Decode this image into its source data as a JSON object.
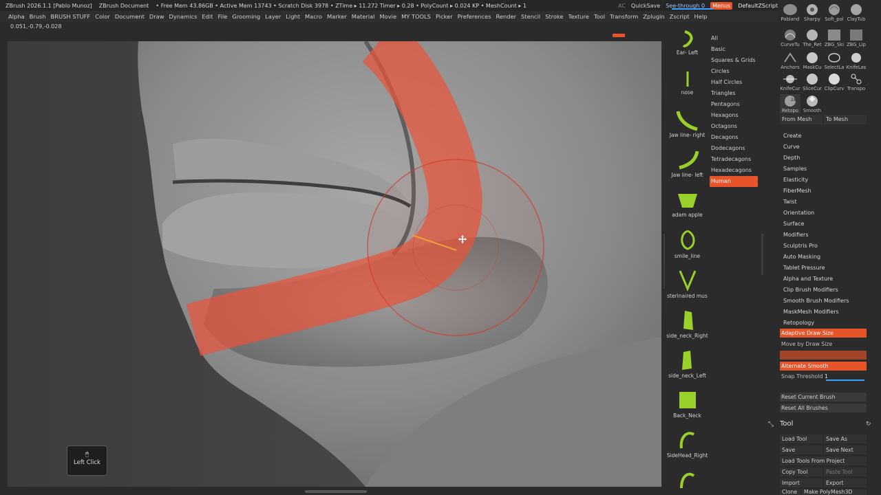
{
  "titlebar": {
    "app": "ZBrush 2026.1.1 [Pablo Munoz]",
    "document": "ZBrush Document",
    "stats": "• Free Mem 43.86GB • Active Mem 13743 • Scratch Disk 3978 • ZTime ▸ 11.272 Timer ▸ 0.28 • PolyCount ▸ 0.024 KP • MeshCount ▸ 1",
    "ac": "AC",
    "quicksave": "QuickSave",
    "see_through_label": "See-through",
    "see_through_value": "0",
    "menus": "Menus",
    "default_script": "DefaultZScript"
  },
  "menubar": [
    "Alpha",
    "Brush",
    "BRUSH STUFF",
    "Color",
    "Document",
    "Draw",
    "Dynamics",
    "Edit",
    "File",
    "Grooming",
    "Layer",
    "Light",
    "Macro",
    "Marker",
    "Material",
    "Movie",
    "MY TOOLS",
    "Picker",
    "Preferences",
    "Render",
    "Stencil",
    "Stroke",
    "Texture",
    "Tool",
    "Transform",
    "Zplugin",
    "Zscript",
    "Help"
  ],
  "coords": "0.051,-0.79,-0.028",
  "viewport": {
    "left_click_label": "Left Click"
  },
  "curves": [
    {
      "label": "Ear- Left",
      "icon": "ear-curve-icon"
    },
    {
      "label": "nose",
      "icon": "nose-curve-icon"
    },
    {
      "label": "Jaw line- right",
      "icon": "jaw-right-curve-icon"
    },
    {
      "label": "Jaw line- left",
      "icon": "jaw-left-curve-icon"
    },
    {
      "label": "adam apple",
      "icon": "adam-apple-curve-icon"
    },
    {
      "label": "smile_line",
      "icon": "smile-line-curve-icon"
    },
    {
      "label": "sterinaired mus",
      "icon": "sternomastoid-curve-icon"
    },
    {
      "label": "side_neck_Right",
      "icon": "side-neck-right-curve-icon"
    },
    {
      "label": "side_neck_Left",
      "icon": "side-neck-left-curve-icon"
    },
    {
      "label": "Back_Neck",
      "icon": "back-neck-curve-icon"
    },
    {
      "label": "SideHead_Right",
      "icon": "sidehead-right-curve-icon"
    }
  ],
  "categories": [
    "All",
    "Basic",
    "Squares & Grids",
    "Circles",
    "Half Circles",
    "Triangles",
    "Pentagons",
    "Hexagons",
    "Octagons",
    "Decagons",
    "Dodecagons",
    "Tetradecagons",
    "Hexadecagons",
    "Human"
  ],
  "selected_category": "Human",
  "brushes": [
    {
      "label": "Pabland"
    },
    {
      "label": "Sharpy"
    },
    {
      "label": "Soft_pol"
    },
    {
      "label": "ClayTub"
    },
    {
      "label": "CurveTu"
    },
    {
      "label": "The_Ret"
    },
    {
      "label": "ZBG_Ski"
    },
    {
      "label": "ZBG_Lip"
    },
    {
      "label": "Anchors"
    },
    {
      "label": "MaskCu"
    },
    {
      "label": "SelectLa"
    },
    {
      "label": "KnifeLas"
    },
    {
      "label": "KnifeCur"
    },
    {
      "label": "SliceCur"
    },
    {
      "label": "ClipCurv"
    },
    {
      "label": "Transpo"
    },
    {
      "label": "Retopo",
      "badge": "28"
    },
    {
      "label": "Smooth"
    }
  ],
  "mesh_buttons": {
    "from": "From Mesh",
    "to": "To Mesh"
  },
  "brush_menu": [
    "Create",
    "Curve",
    "Depth",
    "Samples",
    "Elasticity",
    "FiberMesh",
    "Twist",
    "Orientation",
    "Surface",
    "Modifiers",
    "Sculptris Pro",
    "Auto Masking",
    "Tablet Pressure",
    "Alpha and Texture",
    "Clip Brush Modifiers",
    "Smooth Brush Modifiers",
    "MaskMesh Modifiers",
    "Retopology"
  ],
  "brush_options": {
    "adaptive": "Adaptive Draw Size",
    "move_by": "Move by Draw Size",
    "alternate": "Alternate Smooth",
    "snap_label": "Snap Threshold",
    "snap_value": "1",
    "reset_current": "Reset Current Brush",
    "reset_all": "Reset All Brushes"
  },
  "tool": {
    "title": "Tool",
    "load_tool": "Load Tool",
    "save_as": "Save As",
    "save": "Save",
    "save_next": "Save Next",
    "load_from_project": "Load Tools From Project",
    "copy_tool": "Copy Tool",
    "paste_tool": "Paste Tool",
    "import": "Import",
    "export": "Export",
    "clone": "Clone",
    "make_polymesh": "Make PolyMesh3D"
  },
  "colors": {
    "accent": "#e8542a",
    "blue": "#3aa2ff",
    "stroke": "#e8543a"
  }
}
